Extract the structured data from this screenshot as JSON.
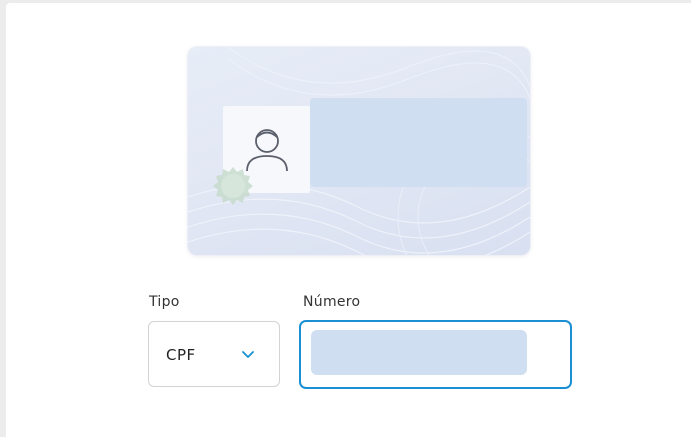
{
  "document_form": {
    "type_label": "Tipo",
    "number_label": "Número",
    "type_select": {
      "selected_value": "CPF",
      "icon": "chevron-down-icon"
    },
    "number_input": {
      "value": ""
    }
  },
  "id_card_illustration": {
    "photo_icon": "person-outline-icon",
    "seal_icon": "seal-badge-icon"
  },
  "colors": {
    "focus_border": "#1a8fd4",
    "placeholder_block": "#cfdff1",
    "chevron": "#1a8fd4"
  }
}
